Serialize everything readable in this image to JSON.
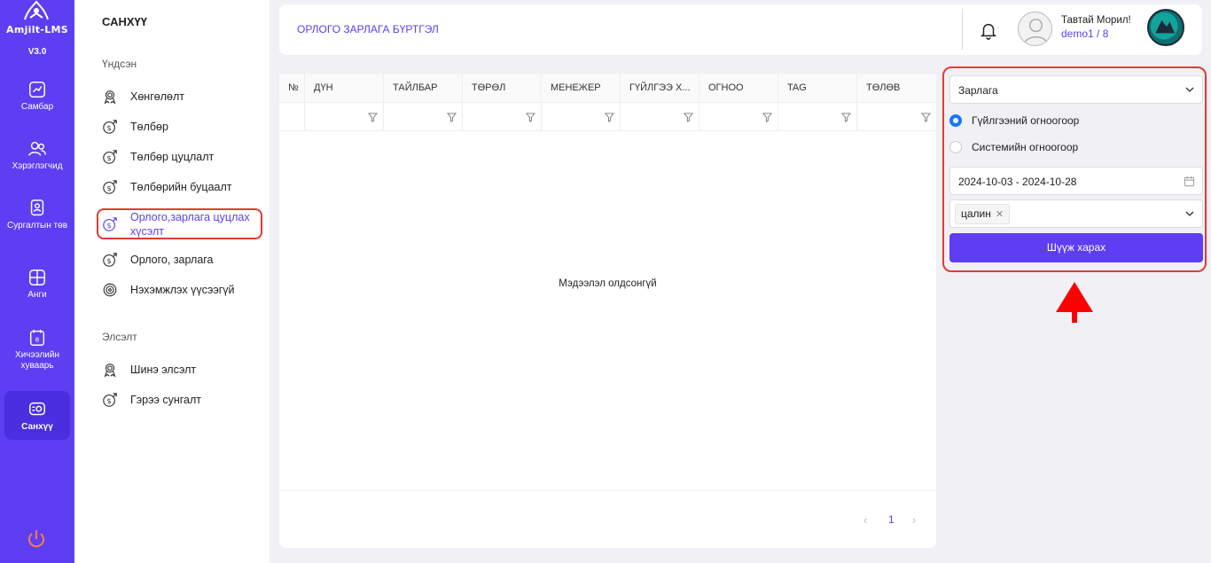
{
  "app": {
    "logo_text": "Amjilt-LMS",
    "version": "V3.0"
  },
  "rail": {
    "items": [
      {
        "label": "Самбар",
        "icon": "chart-icon"
      },
      {
        "label": "Хэрэглэгчид",
        "icon": "users-icon"
      },
      {
        "label": "Сургалтын төв",
        "icon": "badge-icon"
      },
      {
        "label": "Анги",
        "icon": "grid-icon"
      },
      {
        "label": "Хичээлийн хуваарь",
        "icon": "calendar-icon"
      },
      {
        "label": "Санхүү",
        "icon": "finance-icon",
        "active": true
      }
    ]
  },
  "sidebar": {
    "title": "САНХҮҮ",
    "groups": [
      {
        "label": "Үндсэн",
        "items": [
          {
            "label": "Хөнгөлөлт",
            "icon": "award-icon"
          },
          {
            "label": "Төлбөр",
            "icon": "money-icon"
          },
          {
            "label": "Төлбөр цуцлалт",
            "icon": "money-icon"
          },
          {
            "label": "Төлбөрийн буцаалт",
            "icon": "money-icon"
          },
          {
            "label": "Орлого,зарлага цуцлах хүсэлт",
            "icon": "money-icon",
            "active": true
          },
          {
            "label": "Орлого, зарлага",
            "icon": "money-icon"
          },
          {
            "label": "Нэхэмжлэх үүсээгүй",
            "icon": "target-icon"
          }
        ]
      },
      {
        "label": "Элсэлт",
        "items": [
          {
            "label": "Шинэ элсэлт",
            "icon": "award-icon"
          },
          {
            "label": "Гэрээ сунгалт",
            "icon": "money-icon"
          }
        ]
      }
    ]
  },
  "header": {
    "title": "ОРЛОГО ЗАРЛАГА БҮРТГЭЛ",
    "welcome": "Тавтай Морил!",
    "user": "demo1 / 8"
  },
  "table": {
    "columns": [
      "№",
      "ДҮН",
      "ТАЙЛБАР",
      "ТӨРӨЛ",
      "МЕНЕЖЕР",
      "ГҮЙЛГЭЭ Х...",
      "ОГНОО",
      "TAG",
      "ТӨЛӨВ"
    ],
    "empty_text": "Мэдээлэл олдсонгүй",
    "pager": {
      "prev": "‹",
      "current": "1",
      "next": "›"
    }
  },
  "filter": {
    "type_value": "Зарлага",
    "radio_options": [
      {
        "label": "Гүйлгээний огноогоор",
        "checked": true
      },
      {
        "label": "Системийн огноогоор",
        "checked": false
      }
    ],
    "date_range": "2024-10-03 - 2024-10-28",
    "tags": [
      "цалин"
    ],
    "tag_remove": "✕",
    "submit_label": "Шүүж харах"
  },
  "colors": {
    "primary": "#5d3ef2",
    "highlight": "#e53935",
    "radio_on": "#1677ff"
  }
}
